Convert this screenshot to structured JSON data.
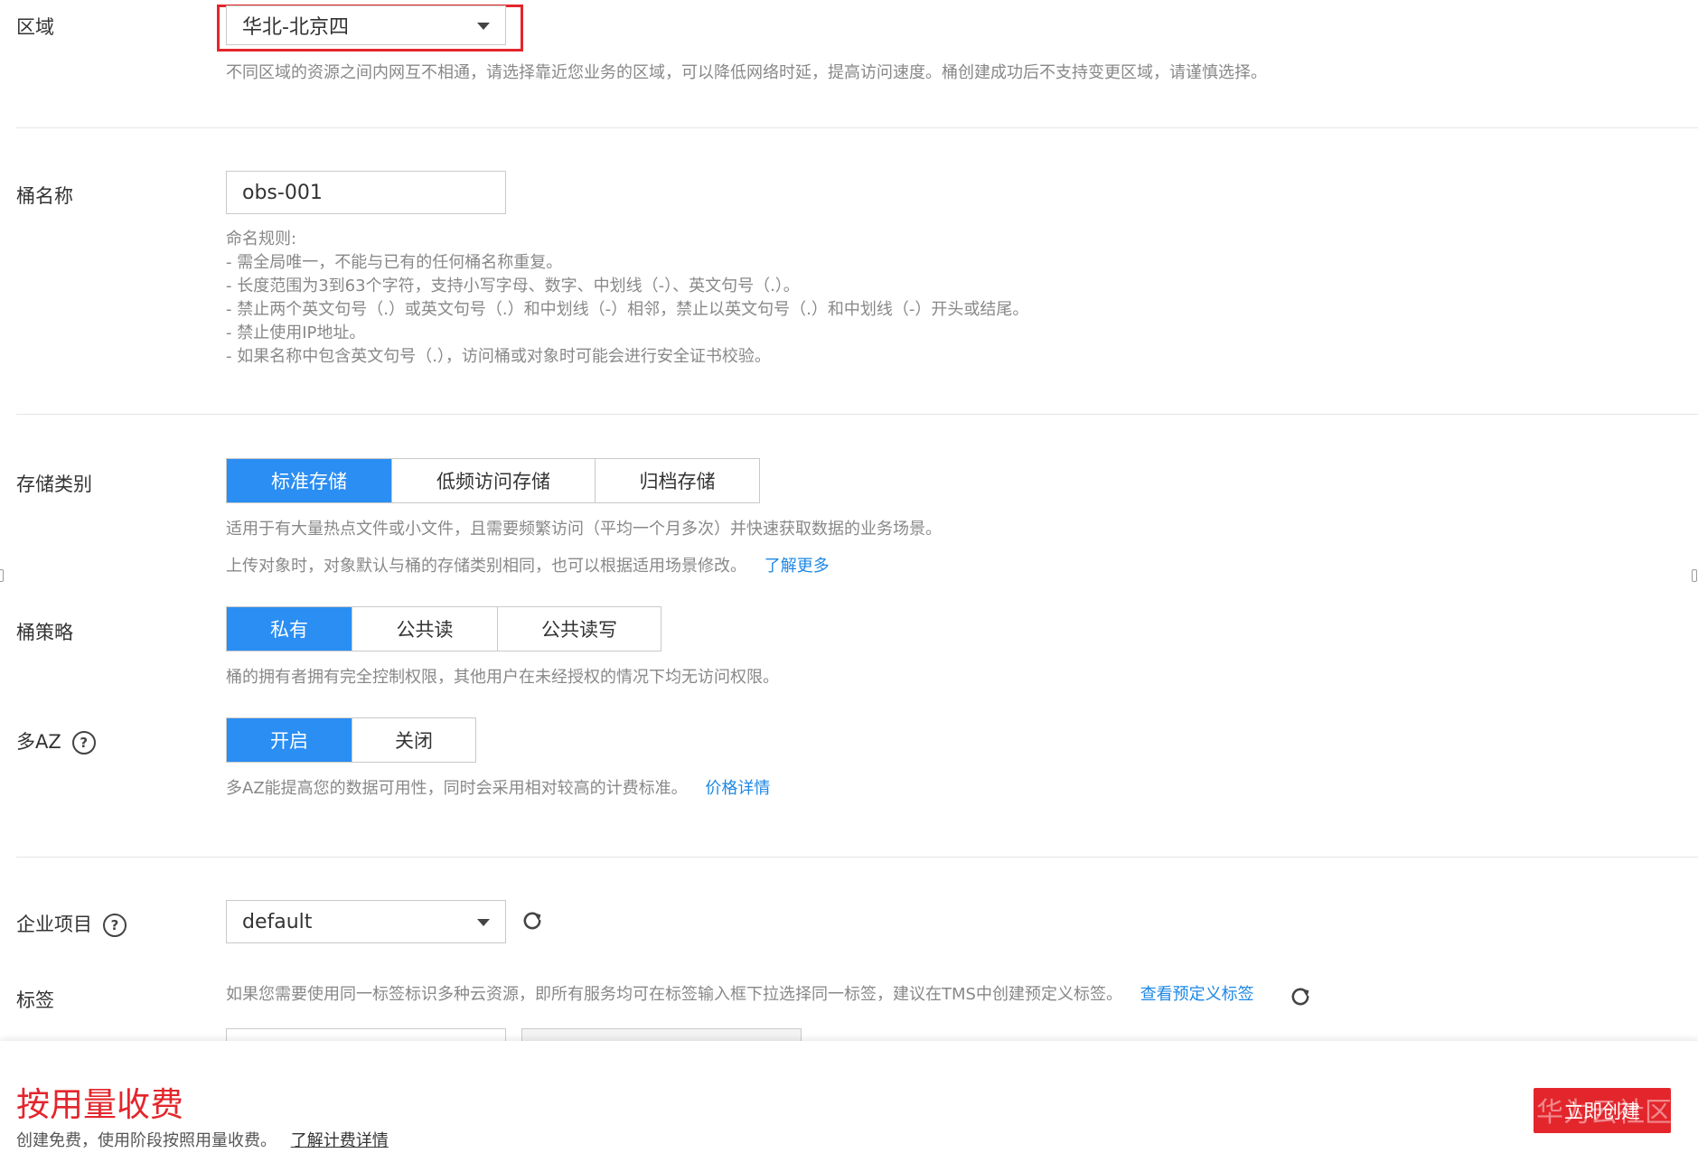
{
  "region": {
    "label": "区域",
    "value": "华北-北京四",
    "help": "不同区域的资源之间内网互不相通，请选择靠近您业务的区域，可以降低网络时延，提高访问速度。桶创建成功后不支持变更区域，请谨慎选择。"
  },
  "bucket_name": {
    "label": "桶名称",
    "value": "obs-001",
    "rules": [
      "命名规则:",
      "- 需全局唯一，不能与已有的任何桶名称重复。",
      "- 长度范围为3到63个字符，支持小写字母、数字、中划线（-）、英文句号（.）。",
      "- 禁止两个英文句号（.）或英文句号（.）和中划线（-）相邻，禁止以英文句号（.）和中划线（-）开头或结尾。",
      "- 禁止使用IP地址。",
      "- 如果名称中包含英文句号（.），访问桶或对象时可能会进行安全证书校验。"
    ]
  },
  "storage_class": {
    "label": "存储类别",
    "options": [
      "标准存储",
      "低频访问存储",
      "归档存储"
    ],
    "selected": "标准存储",
    "help1": "适用于有大量热点文件或小文件，且需要频繁访问（平均一个月多次）并快速获取数据的业务场景。",
    "help2": "上传对象时，对象默认与桶的存储类别相同，也可以根据适用场景修改。",
    "link": "了解更多"
  },
  "bucket_policy": {
    "label": "桶策略",
    "options": [
      "私有",
      "公共读",
      "公共读写"
    ],
    "selected": "私有",
    "help": "桶的拥有者拥有完全控制权限，其他用户在未经授权的情况下均无访问权限。"
  },
  "multi_az": {
    "label": "多AZ",
    "options": [
      "开启",
      "关闭"
    ],
    "selected": "开启",
    "help": "多AZ能提高您的数据可用性，同时会采用相对较高的计费标准。",
    "link": "价格详情"
  },
  "enterprise_project": {
    "label": "企业项目",
    "value": "default"
  },
  "tags": {
    "label": "标签",
    "help": "如果您需要使用同一标签标识多种云资源，即所有服务均可在标签输入框下拉选择同一标签，建议在TMS中创建预定义标签。",
    "link": "查看预定义标签"
  },
  "footer": {
    "fee_title": "按用量收费",
    "fee_sub": "创建免费，使用阶段按照用量收费。",
    "fee_link": "了解计费详情",
    "create_button": "立即创建",
    "watermark": "华为云社区"
  },
  "colors": {
    "primary": "#2b8ef3",
    "link": "#1e88e5",
    "danger": "#e3262c"
  },
  "icons": [
    "caret-down-icon",
    "help-icon",
    "refresh-icon"
  ]
}
